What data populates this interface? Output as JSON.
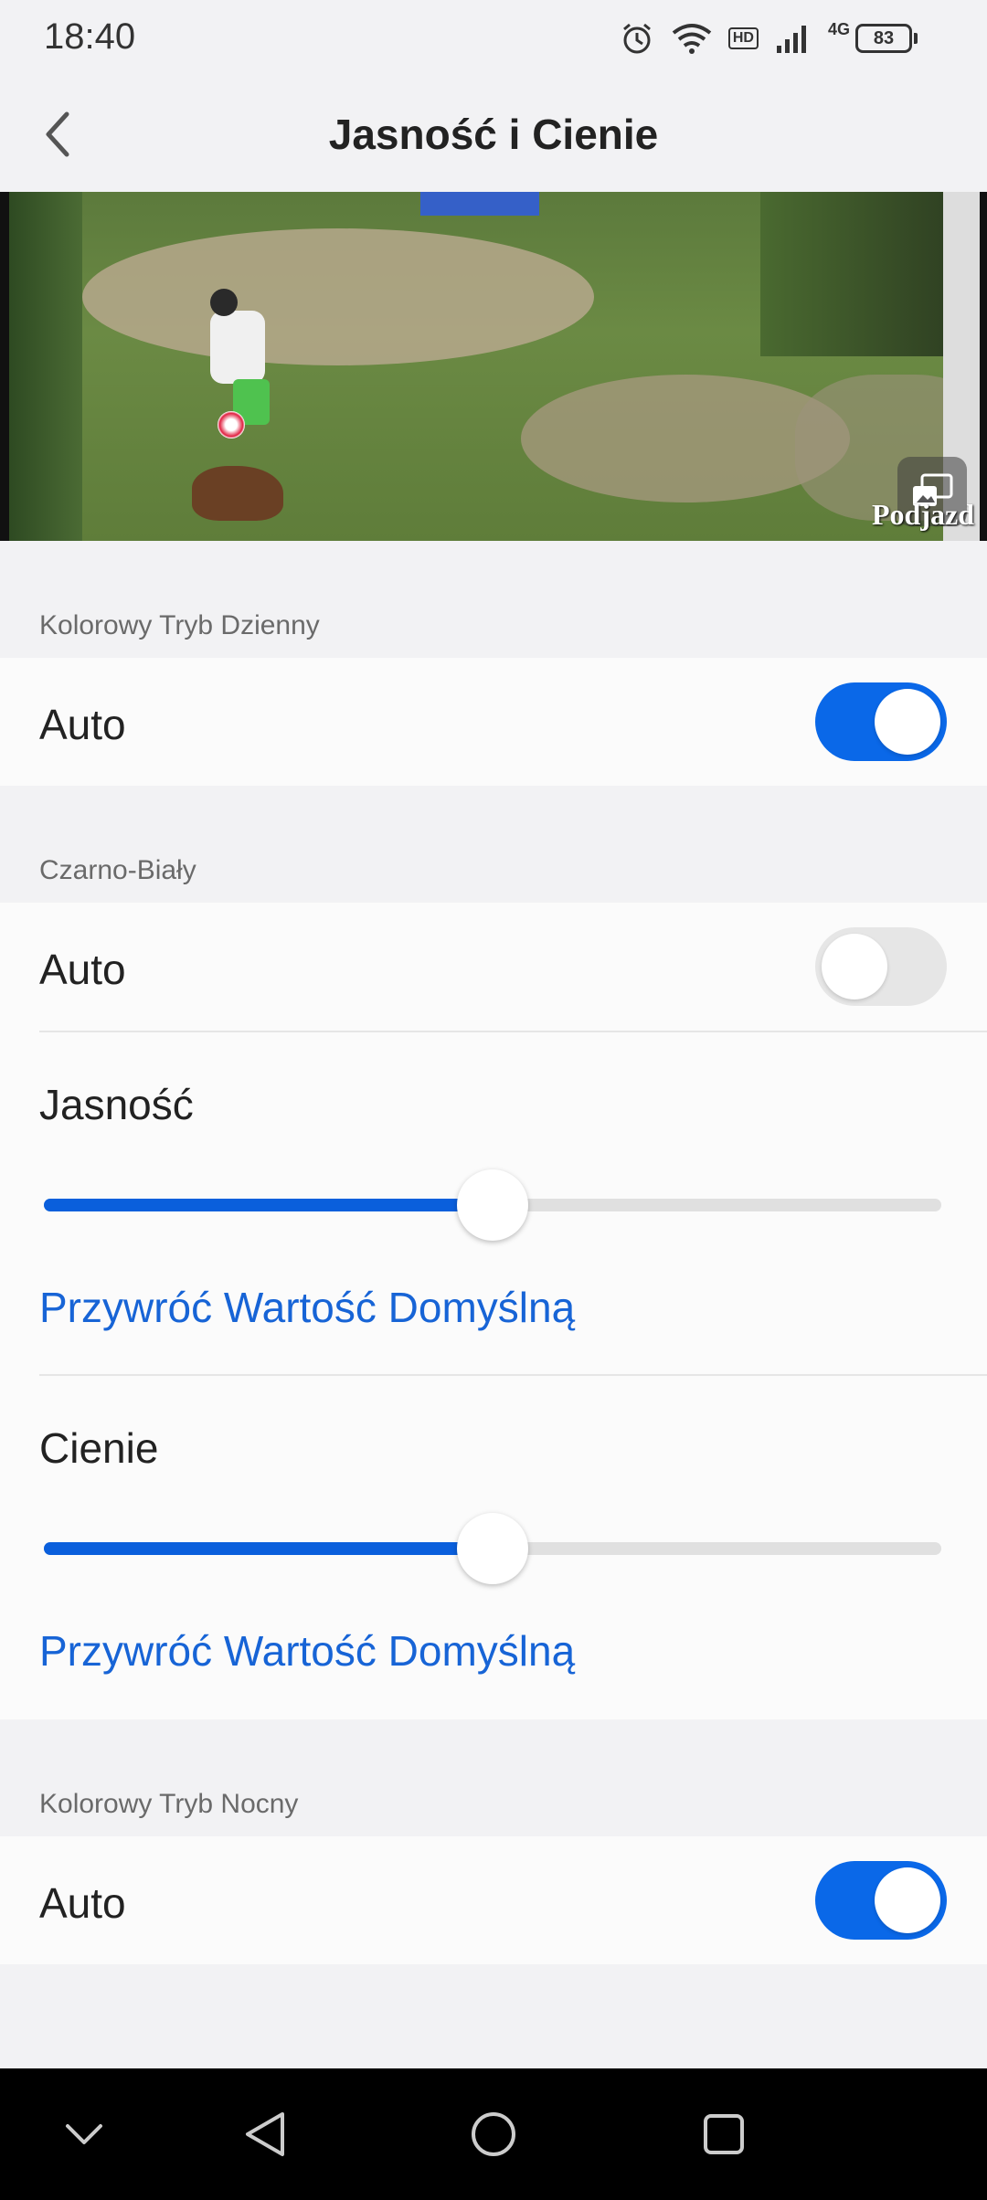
{
  "status_bar": {
    "time": "18:40",
    "icons": [
      "alarm-icon",
      "wifi-icon",
      "hd-icon",
      "signal-icon",
      "battery-icon"
    ],
    "hd_label": "HD",
    "network_label": "4G",
    "battery_level": "83"
  },
  "header": {
    "title": "Jasność i Cienie",
    "back_icon": "chevron-left-icon"
  },
  "video": {
    "watermark": "Podjazd"
  },
  "sections": {
    "day_color": {
      "label": "Kolorowy Tryb Dzienny",
      "auto_label": "Auto",
      "auto_enabled": true
    },
    "black_white": {
      "label": "Czarno-Biały",
      "auto_label": "Auto",
      "auto_enabled": false,
      "brightness_label": "Jasność",
      "brightness_value": 0.5,
      "brightness_reset": "Przywróć Wartość Domyślną",
      "shadows_label": "Cienie",
      "shadows_value": 0.5,
      "shadows_reset": "Przywróć Wartość Domyślną"
    },
    "night_color": {
      "label": "Kolorowy Tryb Nocny",
      "auto_label": "Auto",
      "auto_enabled": true
    }
  },
  "colors": {
    "accent": "#0a68e8",
    "link": "#1764d6",
    "background": "#f2f2f4"
  },
  "nav_bar": {
    "icons": [
      "chevron-down-icon",
      "back-triangle-icon",
      "home-circle-icon",
      "recents-square-icon"
    ]
  }
}
